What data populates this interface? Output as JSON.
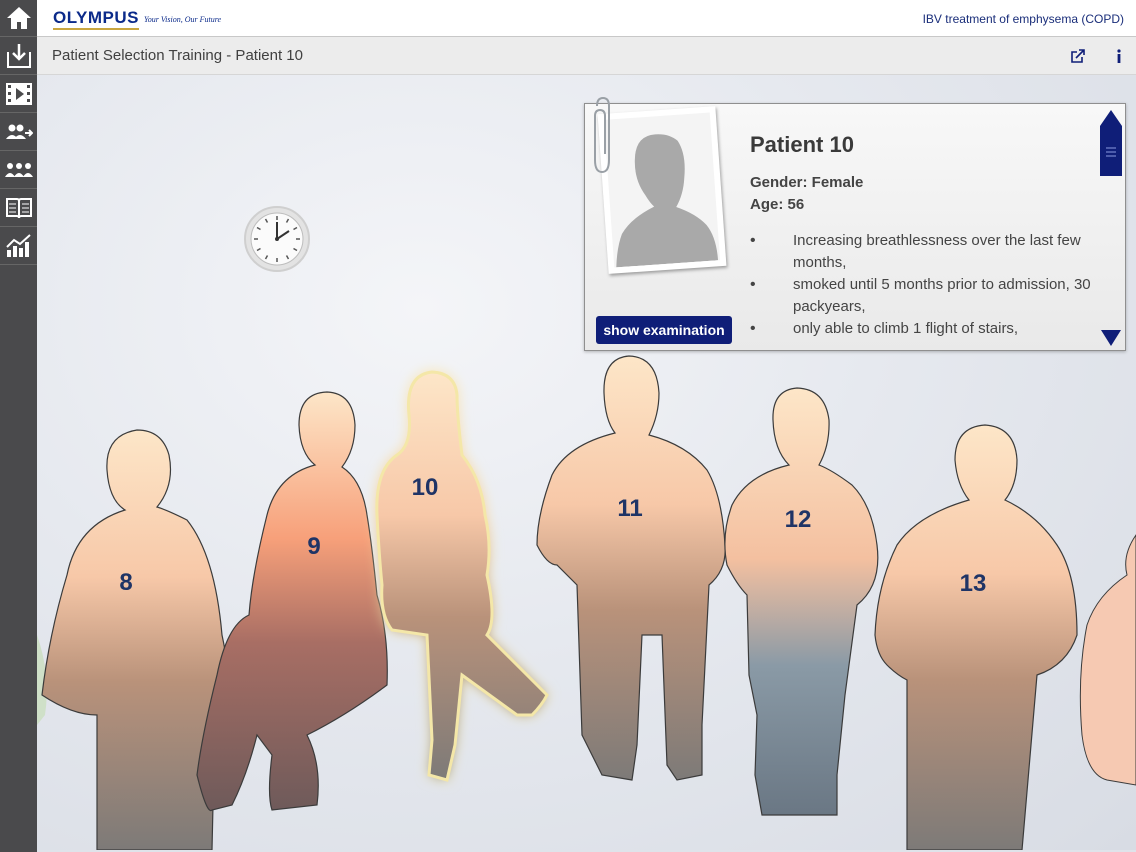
{
  "header": {
    "logo_text": "OLYMPUS",
    "logo_tagline": "Your Vision, Our Future",
    "app_title": "IBV treatment of emphysema (COPD)"
  },
  "sidebar": {
    "items": [
      {
        "icon": "home-icon"
      },
      {
        "icon": "download-icon"
      },
      {
        "icon": "video-icon"
      },
      {
        "icon": "patient-transfer-icon"
      },
      {
        "icon": "patient-group-icon"
      },
      {
        "icon": "book-icon"
      },
      {
        "icon": "chart-icon"
      }
    ]
  },
  "subheader": {
    "title": "Patient Selection Training - Patient 10",
    "icons": [
      "external-link-icon",
      "info-icon"
    ]
  },
  "patients": [
    {
      "number": "8"
    },
    {
      "number": "9"
    },
    {
      "number": "10",
      "selected": true
    },
    {
      "number": "11"
    },
    {
      "number": "12"
    },
    {
      "number": "13"
    }
  ],
  "card": {
    "name": "Patient 10",
    "gender": "Gender: Female",
    "age": "Age: 56",
    "symptoms": [
      "Increasing breathlessness over the last few months,",
      "smoked until 5 months prior to admission, 30 packyears,",
      "only able to climb 1 flight of stairs,"
    ],
    "exam_button": "show examination"
  },
  "colors": {
    "brand_blue": "#0f1e78",
    "sidebar_bg": "#4a4a4c",
    "logo_gold": "#c9a640"
  }
}
